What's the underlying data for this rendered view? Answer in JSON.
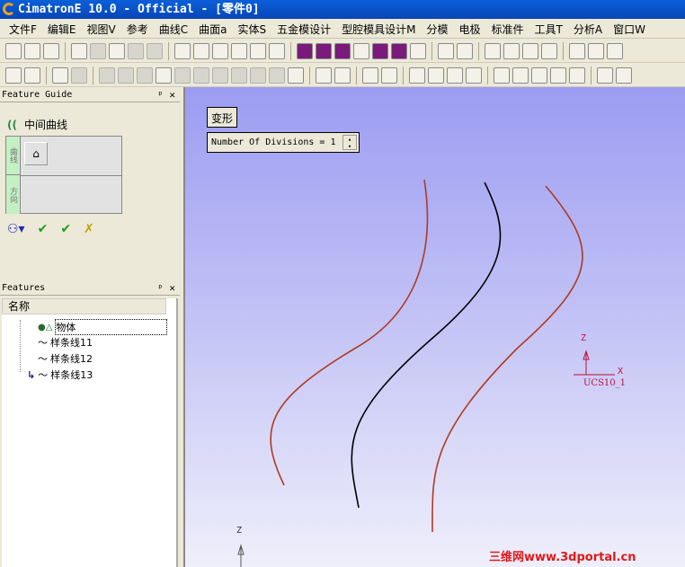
{
  "window": {
    "title": "CimatronE 10.0 - Official - [零件0]"
  },
  "menu": [
    "文件F",
    "编辑E",
    "视图V",
    "参考",
    "曲线C",
    "曲面a",
    "实体S",
    "五金模设计",
    "型腔模具设计M",
    "分模",
    "电极",
    "标准件",
    "工具T",
    "分析A",
    "窗口W"
  ],
  "feature_guide": {
    "header": "Feature Guide",
    "pin": "ᵰ",
    "close": "✕",
    "command": "中间曲线",
    "steps": [
      "曲线",
      "方向"
    ]
  },
  "features": {
    "header": "Features",
    "column": "名称",
    "items": [
      "物体",
      "样条线11",
      "样条线12",
      "样条线13"
    ]
  },
  "viewport": {
    "mode_label": "变形",
    "divisions_label": "Number Of Divisions = 1",
    "ucs_label": "UCS10_1",
    "axis_z": "Z",
    "axis_x": "X",
    "watermark": "三维网www.3dportal.cn",
    "curve_colors": {
      "outer": "#b03a20",
      "middle": "#000000"
    }
  }
}
